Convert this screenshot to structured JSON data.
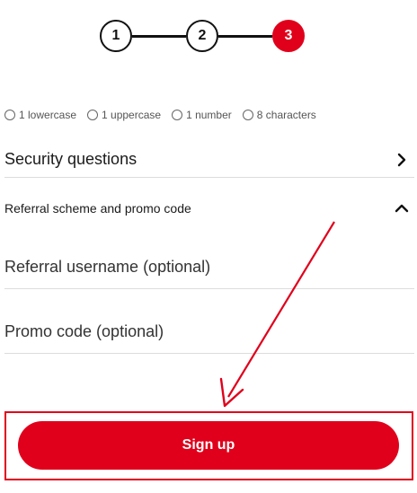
{
  "stepper": {
    "steps": [
      "1",
      "2",
      "3"
    ],
    "active_color": "#e0001b"
  },
  "password_requirements": [
    {
      "label": "1 lowercase"
    },
    {
      "label": "1 uppercase"
    },
    {
      "label": "1 number"
    },
    {
      "label": "8 characters"
    }
  ],
  "security_questions": {
    "label": "Security questions",
    "icon": "chevron-right-icon"
  },
  "referral_section": {
    "label": "Referral scheme and promo code",
    "icon": "chevron-up-icon",
    "referral_field": {
      "placeholder": "Referral username (optional)",
      "value": ""
    },
    "promo_field": {
      "placeholder": "Promo code (optional)",
      "value": ""
    }
  },
  "signup": {
    "label": "Sign up",
    "color": "#e0001b"
  },
  "annotation": {
    "color": "#e0001b",
    "icon": "arrow-annotation"
  }
}
